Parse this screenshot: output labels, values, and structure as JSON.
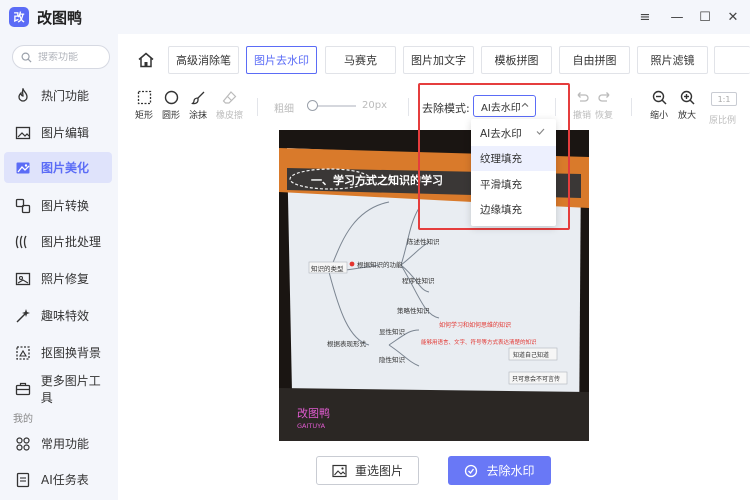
{
  "app": {
    "logo_glyph": "改",
    "title": "改图鸭",
    "window_controls": [
      "≡",
      "—",
      "☐",
      "✕"
    ]
  },
  "sidebar": {
    "search_placeholder": "搜索功能",
    "items": [
      {
        "label": "热门功能",
        "icon": "fire-icon"
      },
      {
        "label": "图片编辑",
        "icon": "image-edit-icon"
      },
      {
        "label": "图片美化",
        "icon": "image-beautify-icon",
        "active": true
      },
      {
        "label": "图片转换",
        "icon": "convert-icon"
      },
      {
        "label": "图片批处理",
        "icon": "batch-icon"
      },
      {
        "label": "照片修复",
        "icon": "photo-repair-icon"
      },
      {
        "label": "趣味特效",
        "icon": "magic-icon"
      },
      {
        "label": "抠图换背景",
        "icon": "cutout-icon"
      },
      {
        "label": "更多图片工具",
        "icon": "toolbox-icon"
      }
    ],
    "section_label": "我的",
    "my_items": [
      {
        "label": "常用功能",
        "icon": "grid-icon"
      },
      {
        "label": "AI任务表",
        "icon": "ai-task-icon"
      }
    ]
  },
  "tabs": {
    "items": [
      "高级消除笔",
      "图片去水印",
      "马赛克",
      "图片加文字",
      "模板拼图",
      "自由拼图",
      "照片滤镜"
    ],
    "active_index": 1
  },
  "toolbar": {
    "tools": [
      {
        "label": "矩形",
        "icon": "rect-select-icon"
      },
      {
        "label": "圆形",
        "icon": "circle-select-icon"
      },
      {
        "label": "涂抹",
        "icon": "brush-icon"
      },
      {
        "label": "橡皮擦",
        "icon": "eraser-icon",
        "disabled": true
      }
    ],
    "thickness_label": "粗细",
    "size_value": "20px",
    "mode_label": "去除模式:",
    "mode_value": "AI去水印",
    "undo_label": "撤销",
    "redo_label": "恢复",
    "zoom_out_label": "缩小",
    "zoom_in_label": "放大",
    "ratio_box": "1:1",
    "ratio_label": "原比例"
  },
  "dropdown": {
    "options": [
      "AI去水印",
      "纹理填充",
      "平滑填充",
      "边缘填充"
    ],
    "selected_index": 0,
    "hover_index": 1
  },
  "photo": {
    "heading": "一、学习方式之知识的学习",
    "nodes": [
      "知识的类型",
      "根据知识的功能",
      "根据表现形式",
      "陈述性知识",
      "程序性知识",
      "策略性知识",
      "显性知识",
      "隐性知识"
    ],
    "red_texts": [
      "如何学习和如何思维的知识",
      "能够用语言、文字、符号等方式表达清楚的知识"
    ],
    "boxes": [
      "知道自己知道",
      "只可意会不可言传"
    ],
    "watermark_title": "改图鸭",
    "watermark_sub": "GAITUYA"
  },
  "actions": {
    "reselect_label": "重选图片",
    "remove_label": "去除水印"
  },
  "colors": {
    "accent": "#5b6cf6",
    "highlight_red": "#e53d3d",
    "primary_button": "#6978f6"
  }
}
